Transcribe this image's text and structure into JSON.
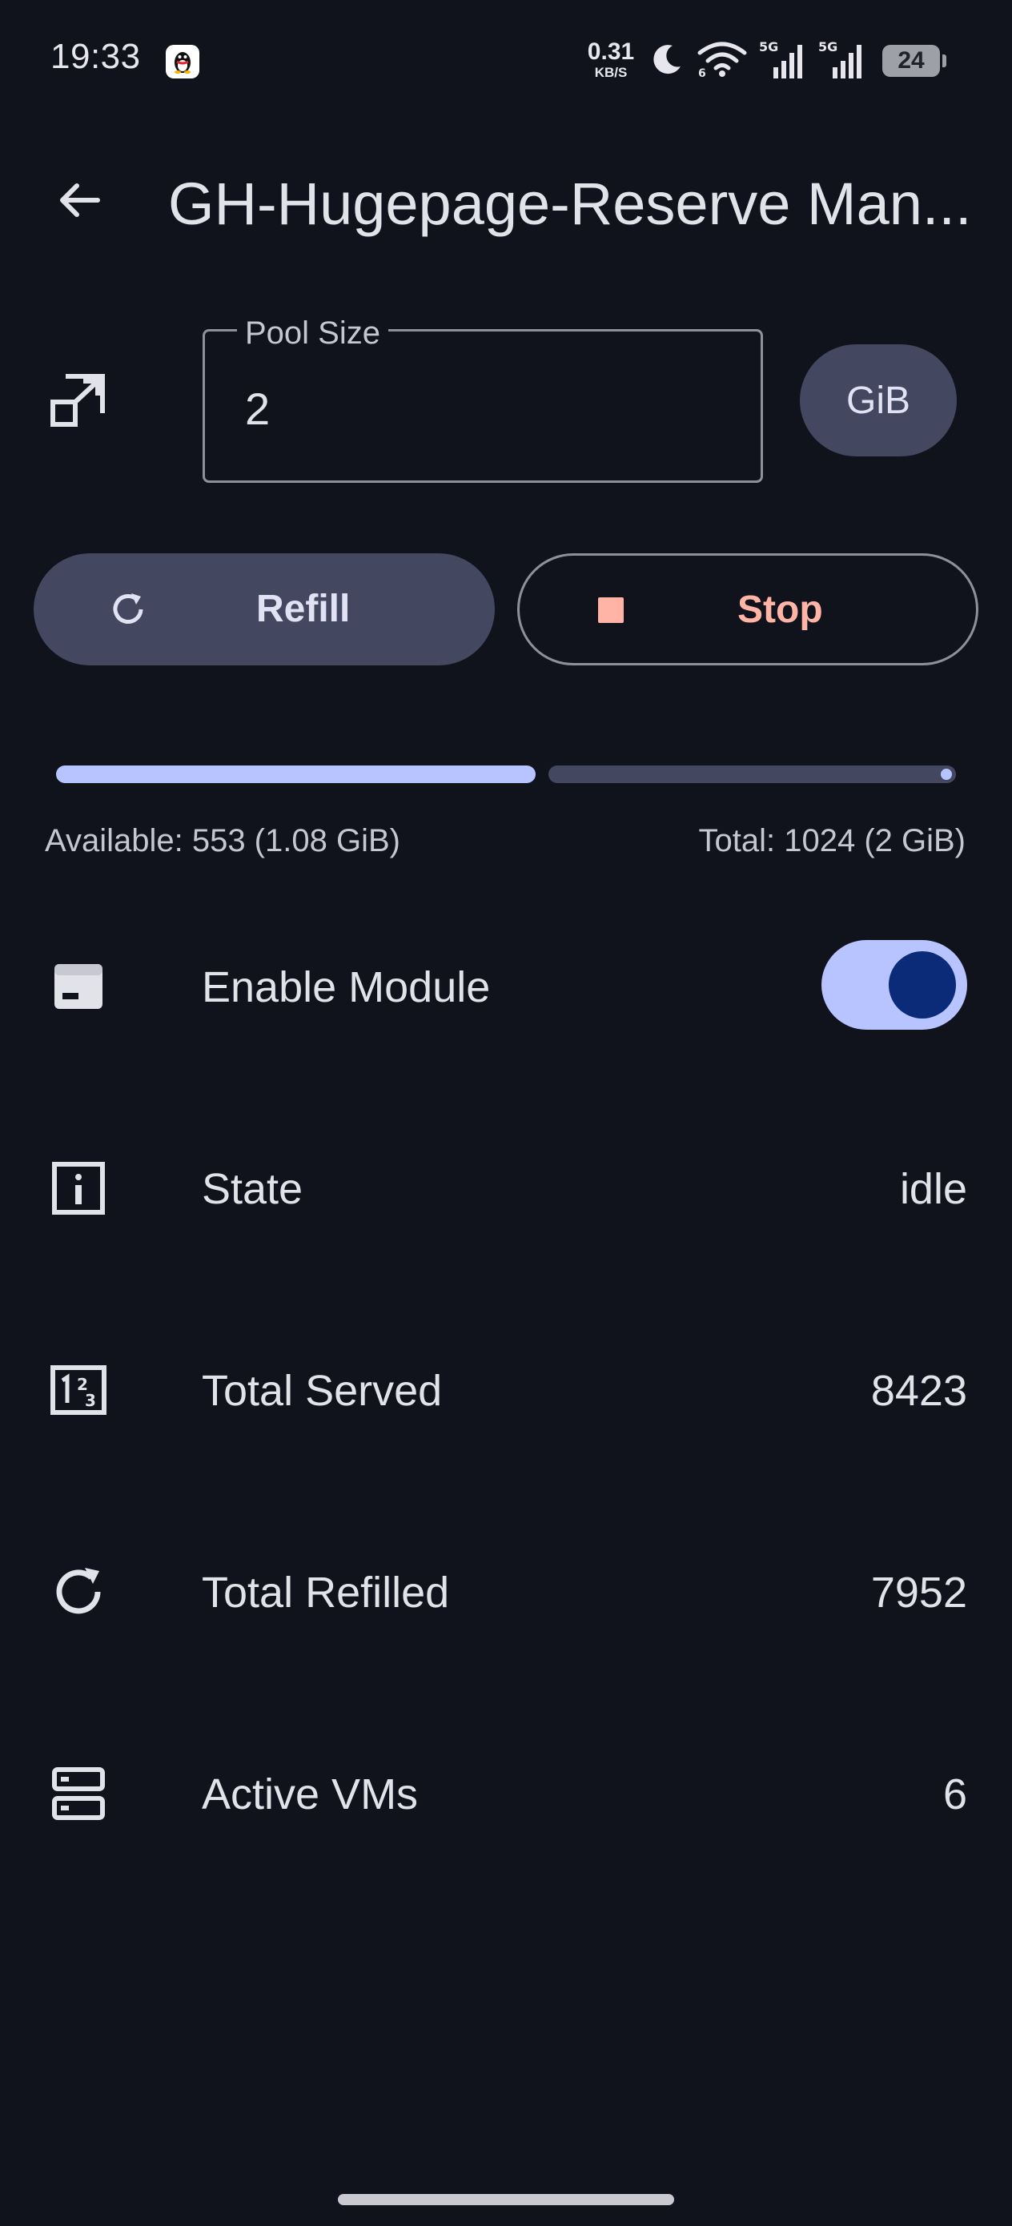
{
  "status_bar": {
    "time": "19:33",
    "net_speed_value": "0.31",
    "net_speed_unit": "KB/S",
    "battery": "24",
    "icons": [
      "qq-icon",
      "moon-icon",
      "wifi-icon",
      "signal-5g-icon",
      "signal-5g-icon",
      "battery-icon"
    ]
  },
  "app_bar": {
    "title": "GH-Hugepage-Reserve Man...",
    "back_icon": "arrow-left-icon"
  },
  "pool": {
    "label": "Pool Size",
    "value": "2",
    "unit": "GiB"
  },
  "actions": {
    "refill": "Refill",
    "stop": "Stop"
  },
  "usage": {
    "available_text": "Available: 553 (1.08 GiB)",
    "total_text": "Total: 1024 (2 GiB)",
    "fill_fraction": 0.54
  },
  "rows": {
    "enable_module": {
      "label": "Enable Module",
      "enabled": true,
      "icon": "sd-card-icon"
    },
    "state": {
      "label": "State",
      "value": "idle",
      "icon": "info-icon"
    },
    "total_served": {
      "label": "Total Served",
      "value": "8423",
      "icon": "numbers-icon"
    },
    "total_refilled": {
      "label": "Total Refilled",
      "value": "7952",
      "icon": "refresh-icon"
    },
    "active_vms": {
      "label": "Active VMs",
      "value": "6",
      "icon": "server-icon"
    }
  },
  "colors": {
    "background": "#11131c",
    "primary": "#b8c4ff",
    "secondary_container": "#444760",
    "error": "#ffb4a5",
    "outline": "#8f909a"
  }
}
